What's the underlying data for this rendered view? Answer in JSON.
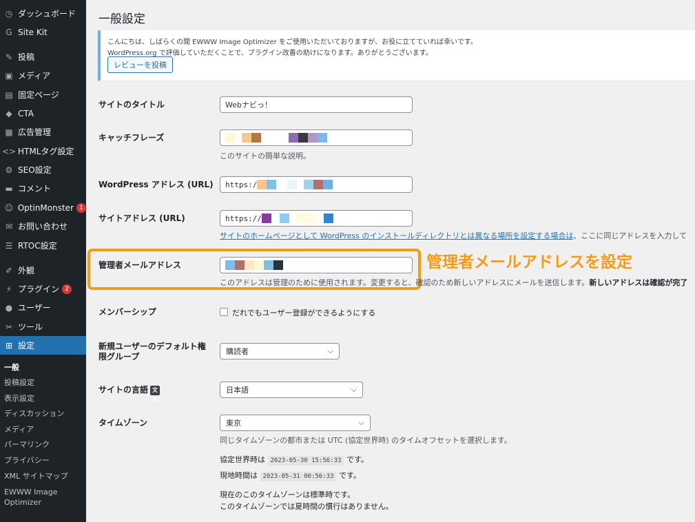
{
  "sidebar": {
    "menu": [
      {
        "label": "ダッシュボード",
        "icon": "dashboard-icon",
        "glyph": "◷"
      },
      {
        "label": "Site Kit",
        "icon": "sitekit-icon",
        "glyph": "G"
      },
      {
        "label": "投稿",
        "icon": "pin-icon",
        "glyph": "✎"
      },
      {
        "label": "メディア",
        "icon": "media-icon",
        "glyph": "▣"
      },
      {
        "label": "固定ページ",
        "icon": "page-icon",
        "glyph": "▤"
      },
      {
        "label": "CTA",
        "icon": "tag-icon",
        "glyph": "◆"
      },
      {
        "label": "広告管理",
        "icon": "ad-icon",
        "glyph": "▦"
      },
      {
        "label": "HTMLタグ設定",
        "icon": "code-icon",
        "glyph": "<>"
      },
      {
        "label": "SEO設定",
        "icon": "gear-icon",
        "glyph": "⚙"
      },
      {
        "label": "コメント",
        "icon": "comment-icon",
        "glyph": "▬"
      },
      {
        "label": "OptinMonster",
        "icon": "optinmonster-icon",
        "glyph": "☺",
        "badge": "1"
      },
      {
        "label": "お問い合わせ",
        "icon": "mail-icon",
        "glyph": "✉"
      },
      {
        "label": "RTOC設定",
        "icon": "list-icon",
        "glyph": "☰"
      },
      {
        "label": "外観",
        "icon": "brush-icon",
        "glyph": "✐"
      },
      {
        "label": "プラグイン",
        "icon": "plugin-icon",
        "glyph": "⚡",
        "badge": "2"
      },
      {
        "label": "ユーザー",
        "icon": "user-icon",
        "glyph": "●"
      },
      {
        "label": "ツール",
        "icon": "wrench-icon",
        "glyph": "✂"
      },
      {
        "label": "設定",
        "icon": "settings-icon",
        "glyph": "⊞"
      }
    ],
    "submenu": [
      "一般",
      "投稿設定",
      "表示設定",
      "ディスカッション",
      "メディア",
      "パーマリンク",
      "プライバシー",
      "XML サイトマップ",
      "EWWW Image Optimizer"
    ]
  },
  "page": {
    "title": "一般設定",
    "notice": {
      "line1": "こんにちは、しばらくの間 EWWW Image Optimizer をご使用いただいておりますが、お役に立てていれば幸いです。",
      "line2": "WordPress.org で評価していただくことで、プラグイン改善の助けになります。ありがとうございます。",
      "button": "レビューを投稿"
    },
    "fields": {
      "site_title_label": "サイトのタイトル",
      "site_title_value": "Webナビっ！",
      "tagline_label": "キャッチフレーズ",
      "tagline_desc": "このサイトの簡単な説明。",
      "wp_address_label": "WordPress アドレス (URL)",
      "wp_address_value": "https:/",
      "site_address_label": "サイトアドレス (URL)",
      "site_address_value": "https://",
      "site_address_desc_link": "サイトのホームページとして WordPress のインストールディレクトリとは異なる場所を設定する場合は",
      "site_address_desc_rest": "、ここに同じアドレスを入力して",
      "admin_email_label": "管理者メールアドレス",
      "admin_email_desc": "このアドレスは管理のために使用されます。変更すると、確認のため新しいアドレスにメールを送信します。",
      "admin_email_desc_bold": "新しいアドレスは確認が完了",
      "membership_label": "メンバーシップ",
      "membership_checkbox": "だれでもユーザー登録ができるようにする",
      "default_role_label": "新規ユーザーのデフォルト権限グループ",
      "default_role_value": "購読者",
      "language_label": "サイトの言語",
      "language_value": "日本語",
      "timezone_label": "タイムゾーン",
      "timezone_value": "東京",
      "timezone_desc": "同じタイムゾーンの都市または UTC (協定世界時) のタイムオフセットを選択します。",
      "utc_label": "協定世界時は",
      "utc_value": "2023-05-30 15:56:33",
      "utc_suffix": "です。",
      "local_label": "現地時間は",
      "local_value": "2023-05-31 00:56:33",
      "local_suffix": "です。",
      "tz_note1": "現在のこのタイムゾーンは標準時です。",
      "tz_note2": "このタイムゾーンでは夏時間の慣行はありません。"
    },
    "annotation": "管理者メールアドレスを設定"
  },
  "colors": {
    "sidebar_bg": "#1d2327",
    "accent": "#2271b1",
    "highlight": "#f39c12",
    "badge": "#d63638"
  }
}
